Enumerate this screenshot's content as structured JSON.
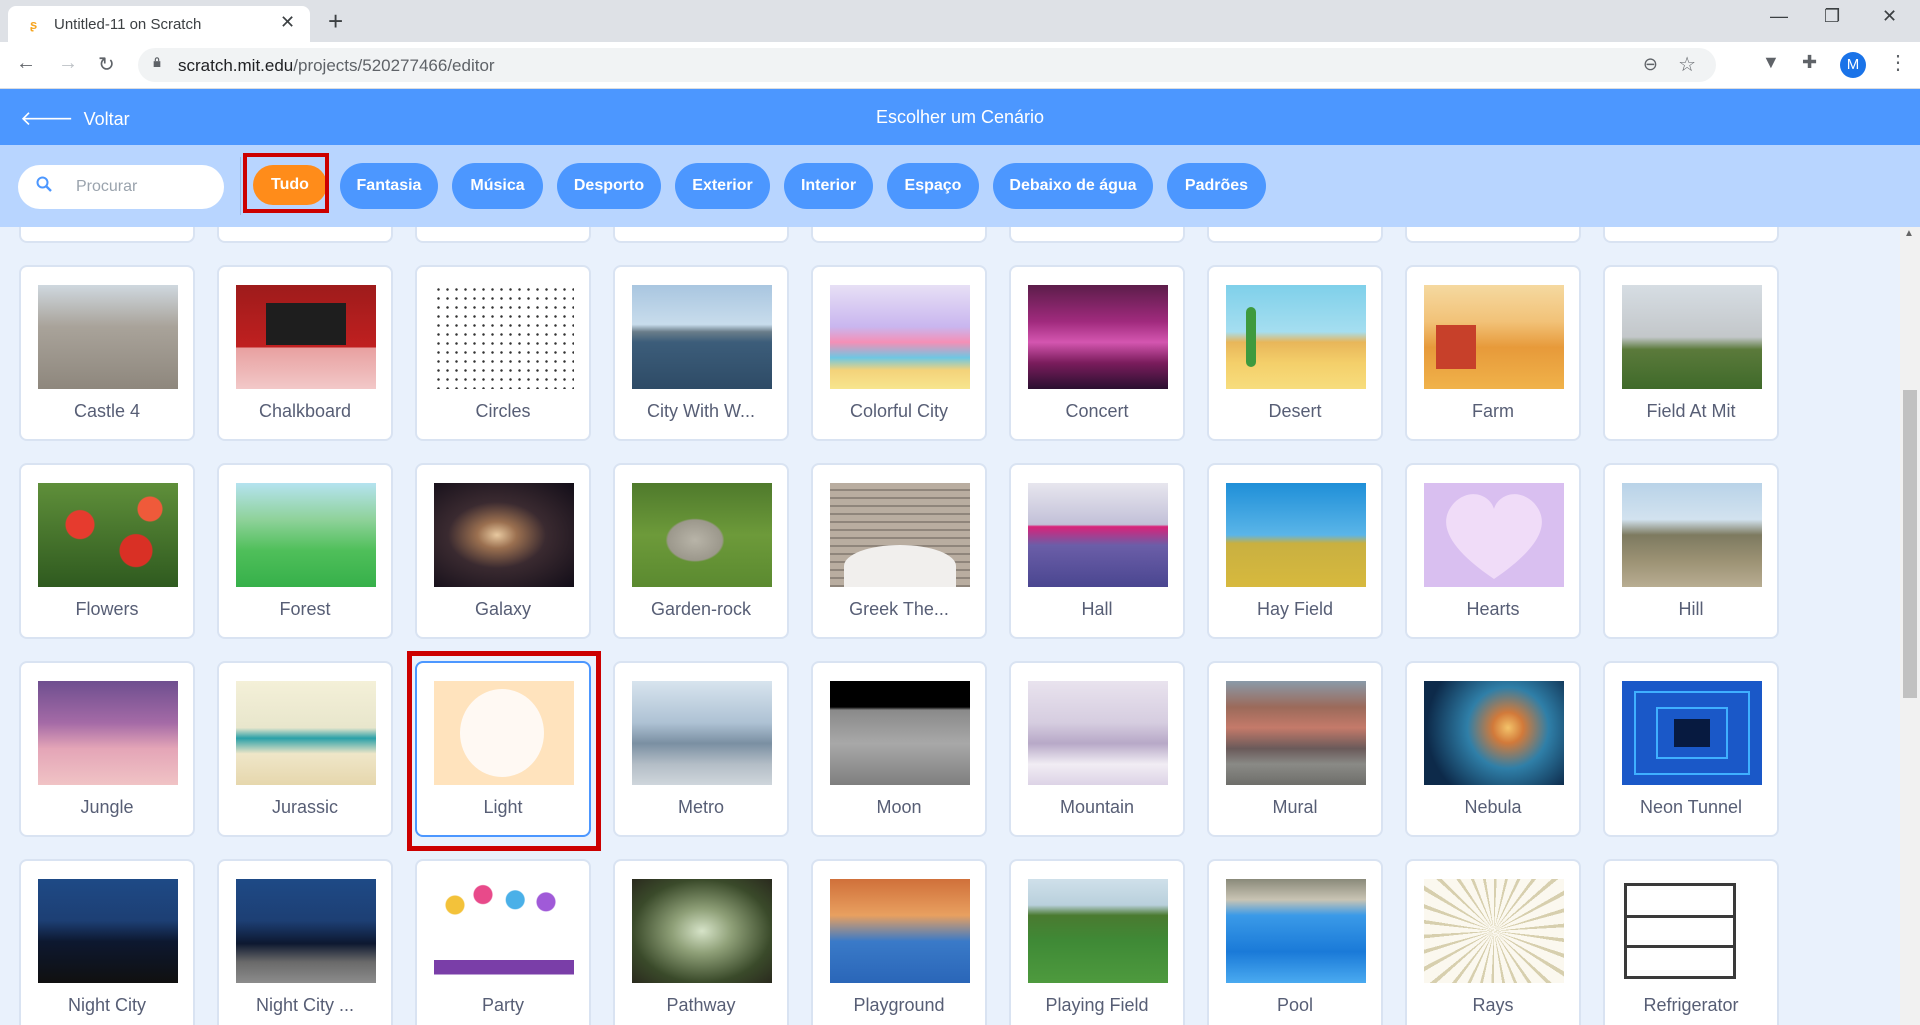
{
  "browser": {
    "tab_title": "Untitled-11 on Scratch",
    "url_host": "scratch.mit.edu",
    "url_path": "/projects/520277466/editor",
    "avatar_initial": "M"
  },
  "header": {
    "back_label": "Voltar",
    "title": "Escolher um Cenário"
  },
  "search": {
    "placeholder": "Procurar"
  },
  "filters": [
    "Tudo",
    "Fantasia",
    "Música",
    "Desporto",
    "Exterior",
    "Interior",
    "Espaço",
    "Debaixo de água",
    "Padrões"
  ],
  "active_filter": "Tudo",
  "backdrops": [
    [
      "Castle 4",
      "Chalkboard",
      "Circles",
      "City With W...",
      "Colorful City",
      "Concert",
      "Desert",
      "Farm",
      "Field At Mit"
    ],
    [
      "Flowers",
      "Forest",
      "Galaxy",
      "Garden-rock",
      "Greek The...",
      "Hall",
      "Hay Field",
      "Hearts",
      "Hill"
    ],
    [
      "Jungle",
      "Jurassic",
      "Light",
      "Metro",
      "Moon",
      "Mountain",
      "Mural",
      "Nebula",
      "Neon Tunnel"
    ],
    [
      "Night City",
      "Night City ...",
      "Party",
      "Pathway",
      "Playground",
      "Playing Field",
      "Pool",
      "Rays",
      "Refrigerator"
    ]
  ],
  "selected_backdrop": "Light",
  "colors": {
    "accent": "#4c97ff",
    "active_pill": "#ff8c1a",
    "highlight": "#cc0000"
  }
}
